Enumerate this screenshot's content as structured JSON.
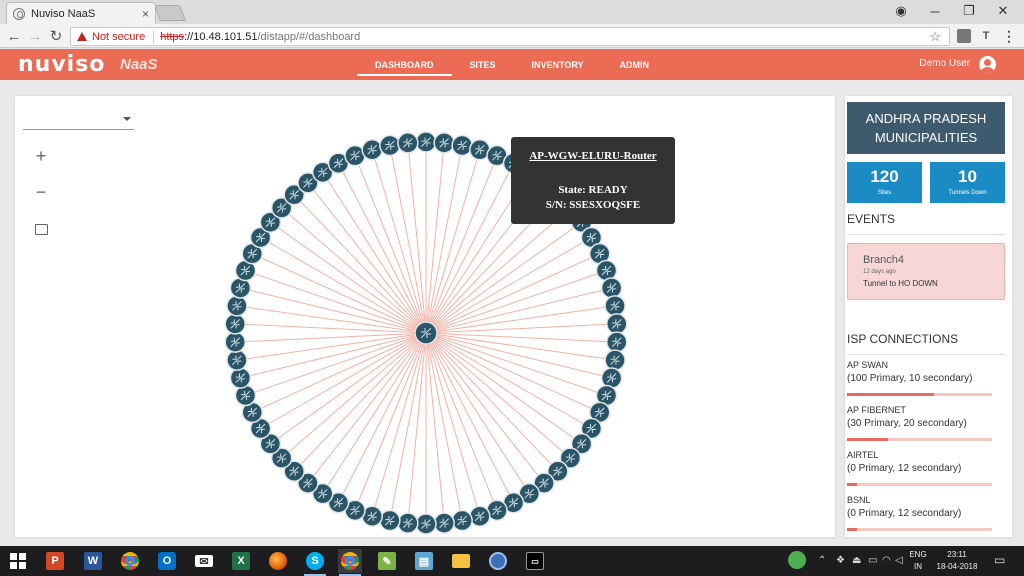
{
  "browser": {
    "tab_title": "Nuviso NaaS",
    "tab_close": "×",
    "not_secure": "Not secure",
    "url_scheme": "https",
    "url_host": "://10.48.101.51",
    "url_path": "/distapp/#/dashboard",
    "window_controls": {
      "account": "◉",
      "minimize": "─",
      "restore": "❐",
      "close": "✕"
    },
    "nav": {
      "back": "←",
      "forward": "→",
      "reload": "↻"
    },
    "bookmark_star": "☆",
    "extension_label": "T",
    "menu": "⋮"
  },
  "app": {
    "brand": "nuviso",
    "product": "NaaS",
    "nav": [
      {
        "label": "DASHBOARD",
        "active": true
      },
      {
        "label": "SITES",
        "active": false
      },
      {
        "label": "INVENTORY",
        "active": false
      },
      {
        "label": "ADMIN",
        "active": false
      }
    ],
    "user": "Demo User"
  },
  "map": {
    "region_select_value": "",
    "zoom_in": "+",
    "zoom_out": "−",
    "hub_node_color": "#2b5566",
    "link_color": "#f3b1a5",
    "tooltip": {
      "title": "AP-WGW-ELURU-Router",
      "state": "State: READY",
      "serial": "S/N: SSESXOQSFE"
    }
  },
  "side": {
    "region_title": "ANDHRA PRADESH MUNICIPALITIES",
    "stats": [
      {
        "value": "120",
        "label": "Sites"
      },
      {
        "value": "10",
        "label": "Tunnels Down"
      }
    ],
    "events_title": "EVENTS",
    "events": [
      {
        "name": "Branch4",
        "time": "12 days ago",
        "message": "Tunnel to HO DOWN"
      }
    ],
    "isp_title": "ISP CONNECTIONS",
    "isps": [
      {
        "name": "AP SWAN",
        "detail": "(100 Primary, 10 secondary)",
        "fill": 0.6
      },
      {
        "name": "AP FIBERNET",
        "detail": "(30 Primary, 20 secondary)",
        "fill": 0.28
      },
      {
        "name": "AIRTEL",
        "detail": "(0 Primary, 12 secondary)",
        "fill": 0.07
      },
      {
        "name": "BSNL",
        "detail": "(0 Primary, 12 secondary)",
        "fill": 0.07
      }
    ],
    "accent_blue": "#1b8bc5",
    "header_color": "#3d5a6e"
  },
  "taskbar": {
    "apps": [
      "powerpoint",
      "word",
      "chrome",
      "outlook",
      "mail",
      "excel",
      "firefox",
      "skype",
      "chrome-2",
      "notepad",
      "archive",
      "explorer",
      "network",
      "terminal"
    ],
    "lang_top": "ENG",
    "lang_bottom": "IN",
    "time": "23:11",
    "date": "18-04-2018"
  }
}
